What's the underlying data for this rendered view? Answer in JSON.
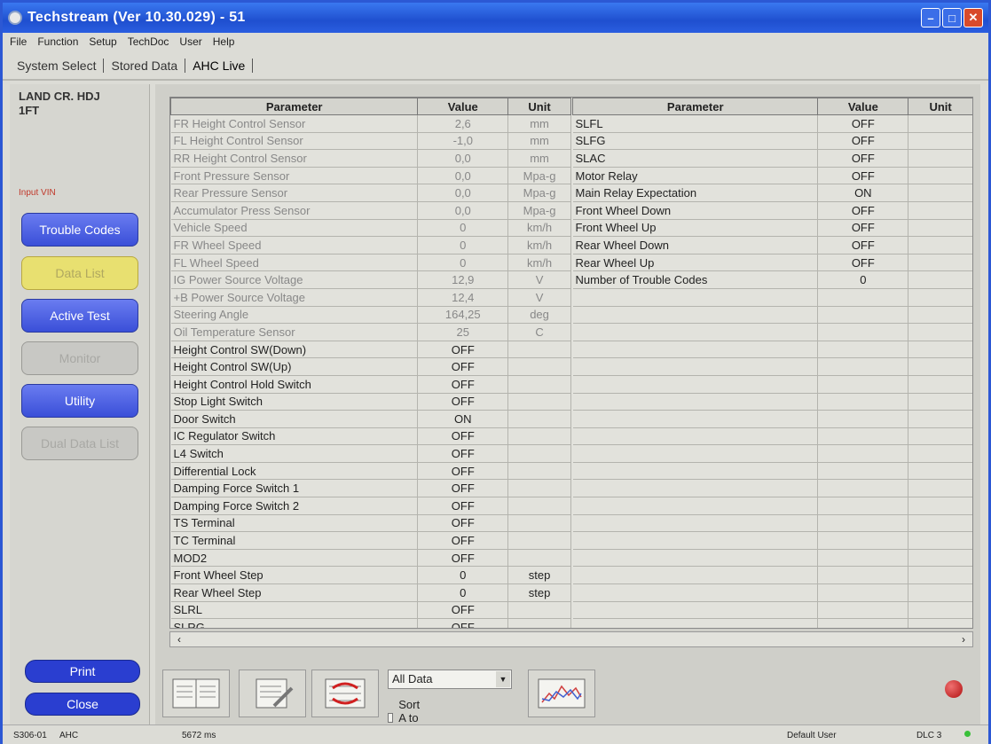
{
  "window": {
    "title": "Techstream (Ver 10.30.029) - 51"
  },
  "menu": [
    "File",
    "Function",
    "Setup",
    "TechDoc",
    "User",
    "Help"
  ],
  "tabs": [
    "System Select",
    "Stored Data",
    "AHC Live"
  ],
  "sidebar": {
    "vehicle_line1": "LAND CR. HDJ",
    "vehicle_line2": "1FT",
    "input_vin": "Input VIN",
    "buttons": [
      "Trouble Codes",
      "Data List",
      "Active Test",
      "Monitor",
      "Utility",
      "Dual Data List"
    ],
    "print": "Print",
    "close": "Close"
  },
  "table_headers": {
    "parameter": "Parameter",
    "value": "Value",
    "unit": "Unit"
  },
  "left_rows": [
    {
      "p": "FR Height Control Sensor",
      "v": "2,6",
      "u": "mm"
    },
    {
      "p": "FL Height Control Sensor",
      "v": "-1,0",
      "u": "mm"
    },
    {
      "p": "RR Height Control Sensor",
      "v": "0,0",
      "u": "mm"
    },
    {
      "p": "Front Pressure Sensor",
      "v": "0,0",
      "u": "Mpa-g"
    },
    {
      "p": "Rear Pressure Sensor",
      "v": "0,0",
      "u": "Mpa-g"
    },
    {
      "p": "Accumulator Press Sensor",
      "v": "0,0",
      "u": "Mpa-g"
    },
    {
      "p": "Vehicle Speed",
      "v": "0",
      "u": "km/h"
    },
    {
      "p": "FR Wheel Speed",
      "v": "0",
      "u": "km/h"
    },
    {
      "p": "FL Wheel Speed",
      "v": "0",
      "u": "km/h"
    },
    {
      "p": "IG Power Source Voltage",
      "v": "12,9",
      "u": "V"
    },
    {
      "p": "+B Power Source Voltage",
      "v": "12,4",
      "u": "V"
    },
    {
      "p": "Steering Angle",
      "v": "164,25",
      "u": "deg"
    },
    {
      "p": "Oil Temperature Sensor",
      "v": "25",
      "u": "C"
    },
    {
      "p": "Height Control SW(Down)",
      "v": "OFF",
      "u": ""
    },
    {
      "p": "Height Control SW(Up)",
      "v": "OFF",
      "u": ""
    },
    {
      "p": "Height Control Hold Switch",
      "v": "OFF",
      "u": ""
    },
    {
      "p": "Stop Light Switch",
      "v": "OFF",
      "u": ""
    },
    {
      "p": "Door Switch",
      "v": "ON",
      "u": ""
    },
    {
      "p": "IC Regulator Switch",
      "v": "OFF",
      "u": ""
    },
    {
      "p": "L4 Switch",
      "v": "OFF",
      "u": ""
    },
    {
      "p": "Differential Lock",
      "v": "OFF",
      "u": ""
    },
    {
      "p": "Damping Force Switch 1",
      "v": "OFF",
      "u": ""
    },
    {
      "p": "Damping Force Switch 2",
      "v": "OFF",
      "u": ""
    },
    {
      "p": "TS Terminal",
      "v": "OFF",
      "u": ""
    },
    {
      "p": "TC Terminal",
      "v": "OFF",
      "u": ""
    },
    {
      "p": "MOD2",
      "v": "OFF",
      "u": ""
    },
    {
      "p": "Front Wheel Step",
      "v": "0",
      "u": "step"
    },
    {
      "p": "Rear Wheel Step",
      "v": "0",
      "u": "step"
    },
    {
      "p": "SLRL",
      "v": "OFF",
      "u": ""
    },
    {
      "p": "SLRG",
      "v": "OFF",
      "u": ""
    }
  ],
  "right_rows": [
    {
      "p": "SLFL",
      "v": "OFF",
      "u": ""
    },
    {
      "p": "SLFG",
      "v": "OFF",
      "u": ""
    },
    {
      "p": "SLAC",
      "v": "OFF",
      "u": ""
    },
    {
      "p": "Motor Relay",
      "v": "OFF",
      "u": ""
    },
    {
      "p": "Main Relay Expectation",
      "v": "ON",
      "u": ""
    },
    {
      "p": "Front Wheel Down",
      "v": "OFF",
      "u": ""
    },
    {
      "p": "Front Wheel Up",
      "v": "OFF",
      "u": ""
    },
    {
      "p": "Rear Wheel Down",
      "v": "OFF",
      "u": ""
    },
    {
      "p": "Rear Wheel Up",
      "v": "OFF",
      "u": ""
    },
    {
      "p": "Number of Trouble Codes",
      "v": "0",
      "u": ""
    }
  ],
  "toolbar": {
    "data_filter": "All Data",
    "sort_label": "Sort A to Z"
  },
  "status": {
    "code": "S306-01",
    "system": "AHC",
    "time": "5672 ms",
    "user": "Default User",
    "dlc": "DLC 3"
  }
}
